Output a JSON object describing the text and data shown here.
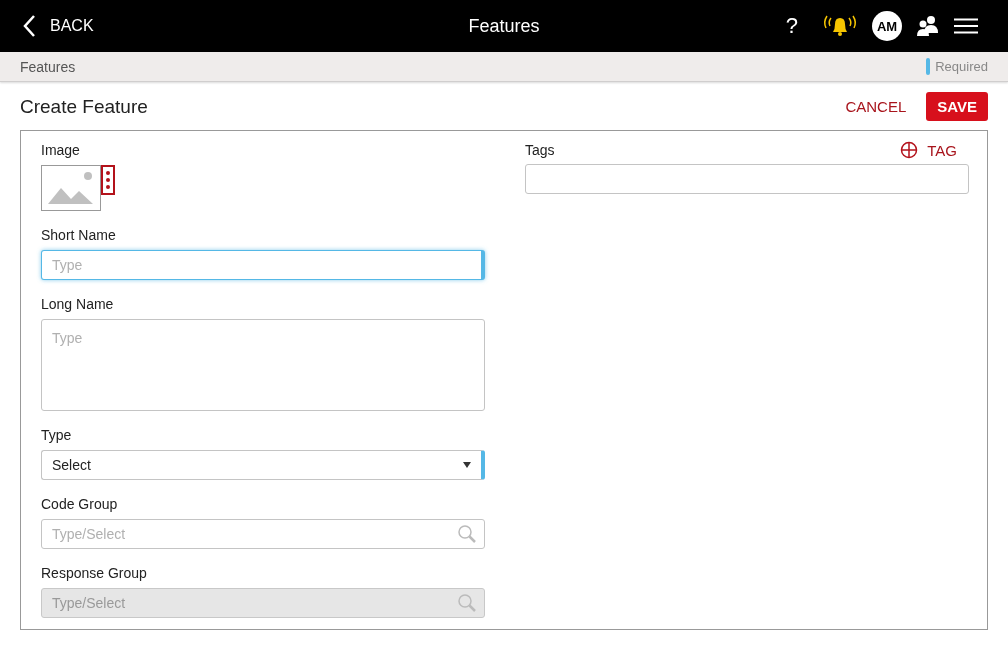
{
  "header": {
    "back_label": "BACK",
    "title": "Features",
    "help": "?",
    "avatar_initials": "AM"
  },
  "breadcrumb": {
    "label": "Features",
    "required_legend": "Required"
  },
  "page": {
    "title": "Create Feature",
    "buttons": [
      {
        "kind": "text",
        "label": "CANCEL"
      },
      {
        "kind": "primary",
        "label": "SAVE"
      }
    ]
  },
  "form": {
    "image": {
      "label": "Image"
    },
    "fields": [
      {
        "kind": "text",
        "label": "Short Name",
        "placeholder": "Type",
        "required": true,
        "focused": true,
        "disabled": false
      },
      {
        "kind": "textarea",
        "label": "Long Name",
        "placeholder": "Type",
        "required": false,
        "focused": false,
        "disabled": false
      },
      {
        "kind": "select",
        "label": "Type",
        "value": "Select",
        "required": true,
        "focused": false,
        "disabled": false
      },
      {
        "kind": "search",
        "label": "Code Group",
        "placeholder": "Type/Select",
        "required": false,
        "focused": false,
        "disabled": false
      },
      {
        "kind": "search",
        "label": "Response Group",
        "placeholder": "Type/Select",
        "required": false,
        "focused": false,
        "disabled": true
      }
    ],
    "tags": {
      "label": "Tags",
      "add_label": "TAG"
    }
  }
}
